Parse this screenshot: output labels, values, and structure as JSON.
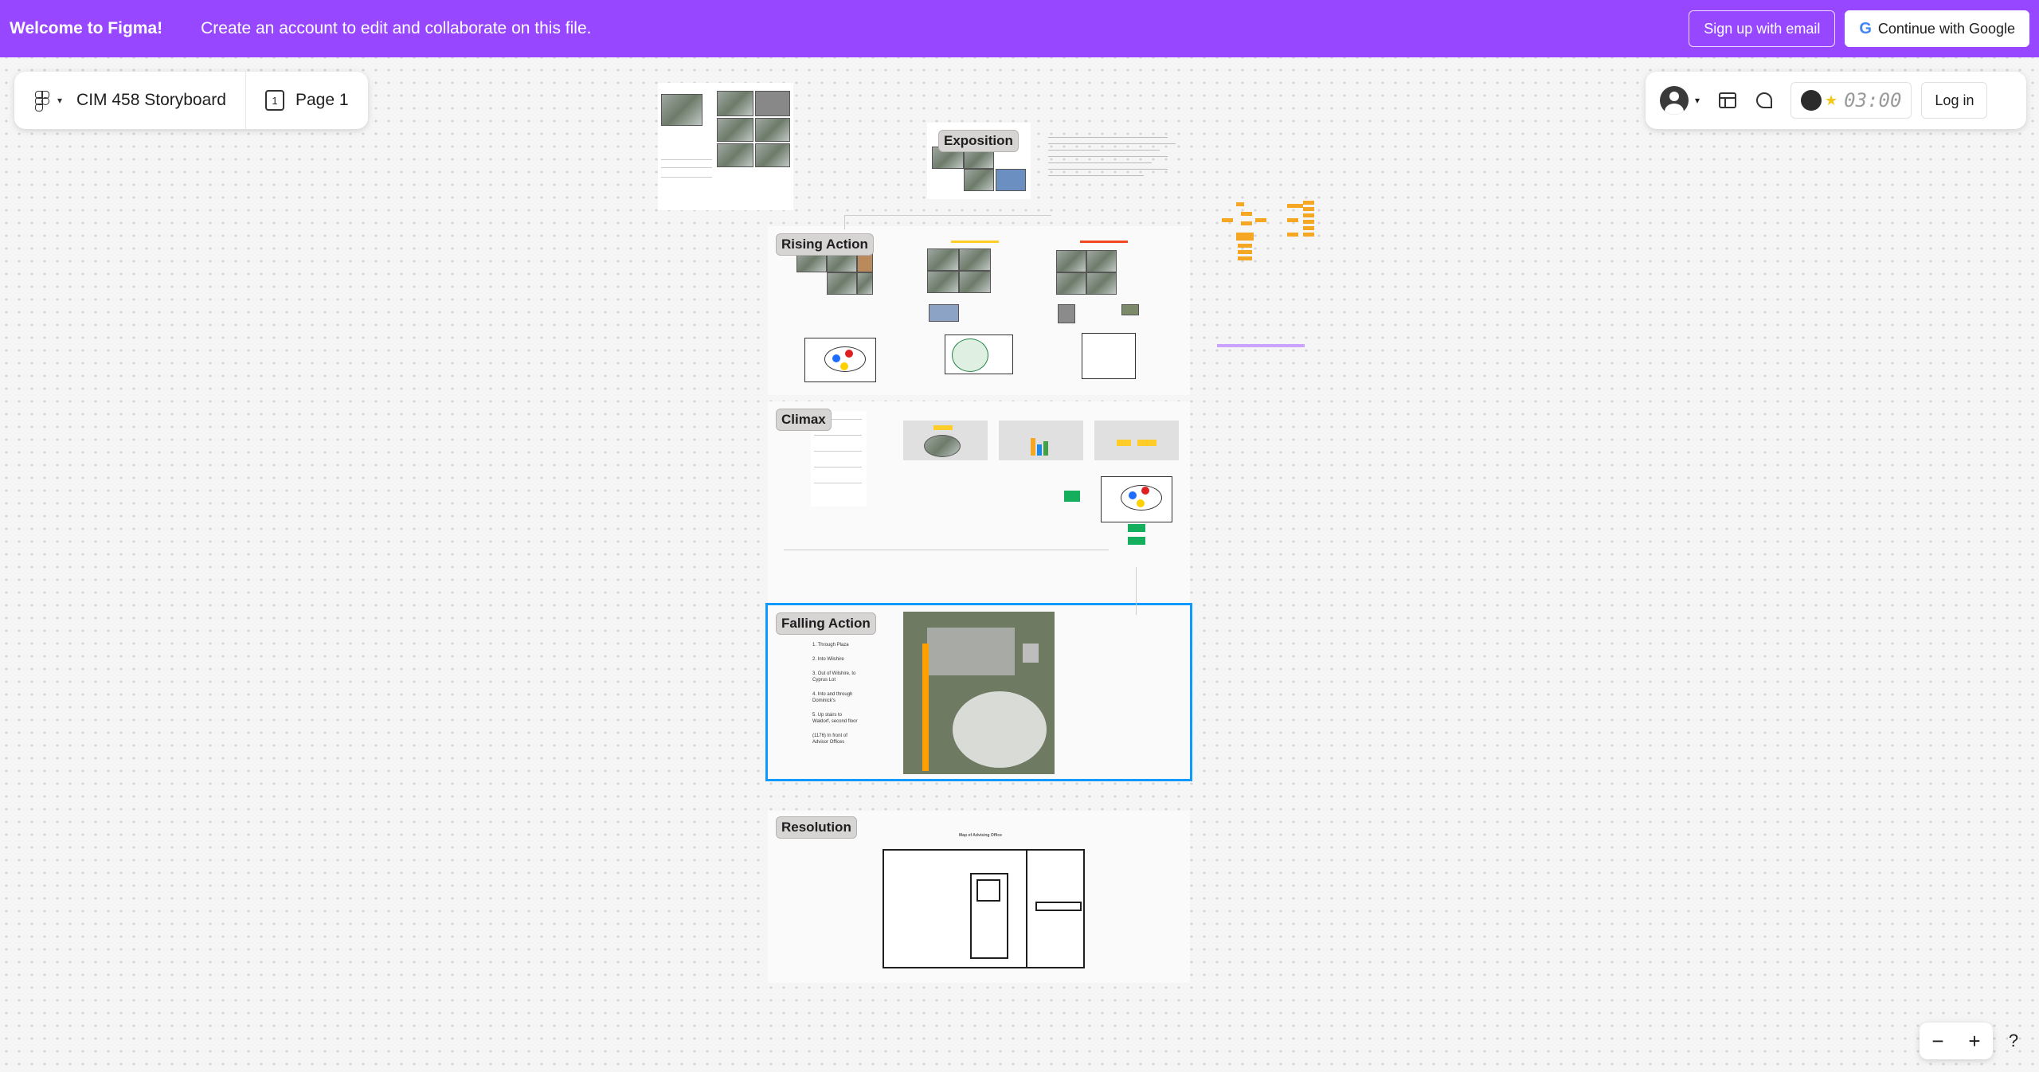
{
  "banner": {
    "welcome": "Welcome to Figma!",
    "subtitle": "Create an account to edit and collaborate on this file.",
    "signup_email": "Sign up with email",
    "continue_google": "Continue with Google",
    "google_glyph": "G"
  },
  "toolbar": {
    "file_name": "CIM 458 Storyboard",
    "page_name": "Page 1",
    "page_number": "1"
  },
  "right_toolbar": {
    "timer": "03:00",
    "login": "Log in"
  },
  "sections": {
    "exposition": "Exposition",
    "rising_action": "Rising Action",
    "climax": "Climax",
    "falling_action": "Falling Action",
    "resolution": "Resolution"
  },
  "falling_action_steps": [
    "1. Through Plaza",
    "2. Into Wilshire",
    "3. Out of Wilshire, to Cyprus Lot",
    "4. Into and through Dominick's",
    "5. Up stairs to Waldorf, second floor",
    "(1176) In front of Advisor Offices"
  ],
  "resolution_caption": "Map of Advising Office",
  "zoom": {
    "out": "−",
    "in": "+",
    "help": "?"
  },
  "icons": [
    "figma-logo-icon",
    "chevron-down-icon",
    "page-icon",
    "user-avatar-icon",
    "layout-icon",
    "comment-icon",
    "timer-icon",
    "zoom-out-icon",
    "zoom-in-icon",
    "help-icon"
  ]
}
